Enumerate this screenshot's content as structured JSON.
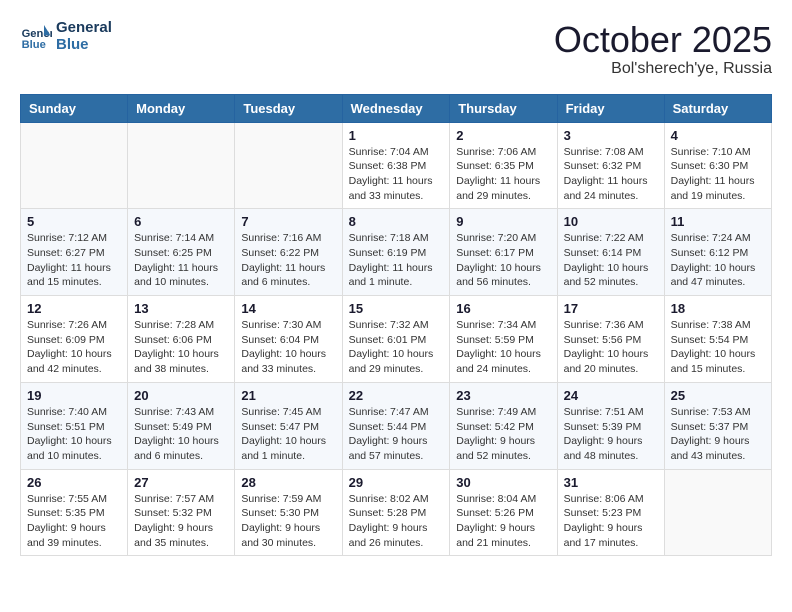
{
  "header": {
    "logo_line1": "General",
    "logo_line2": "Blue",
    "month_title": "October 2025",
    "location": "Bol'sherech'ye, Russia"
  },
  "days_of_week": [
    "Sunday",
    "Monday",
    "Tuesday",
    "Wednesday",
    "Thursday",
    "Friday",
    "Saturday"
  ],
  "weeks": [
    [
      {
        "day": "",
        "info": ""
      },
      {
        "day": "",
        "info": ""
      },
      {
        "day": "",
        "info": ""
      },
      {
        "day": "1",
        "info": "Sunrise: 7:04 AM\nSunset: 6:38 PM\nDaylight: 11 hours and 33 minutes."
      },
      {
        "day": "2",
        "info": "Sunrise: 7:06 AM\nSunset: 6:35 PM\nDaylight: 11 hours and 29 minutes."
      },
      {
        "day": "3",
        "info": "Sunrise: 7:08 AM\nSunset: 6:32 PM\nDaylight: 11 hours and 24 minutes."
      },
      {
        "day": "4",
        "info": "Sunrise: 7:10 AM\nSunset: 6:30 PM\nDaylight: 11 hours and 19 minutes."
      }
    ],
    [
      {
        "day": "5",
        "info": "Sunrise: 7:12 AM\nSunset: 6:27 PM\nDaylight: 11 hours and 15 minutes."
      },
      {
        "day": "6",
        "info": "Sunrise: 7:14 AM\nSunset: 6:25 PM\nDaylight: 11 hours and 10 minutes."
      },
      {
        "day": "7",
        "info": "Sunrise: 7:16 AM\nSunset: 6:22 PM\nDaylight: 11 hours and 6 minutes."
      },
      {
        "day": "8",
        "info": "Sunrise: 7:18 AM\nSunset: 6:19 PM\nDaylight: 11 hours and 1 minute."
      },
      {
        "day": "9",
        "info": "Sunrise: 7:20 AM\nSunset: 6:17 PM\nDaylight: 10 hours and 56 minutes."
      },
      {
        "day": "10",
        "info": "Sunrise: 7:22 AM\nSunset: 6:14 PM\nDaylight: 10 hours and 52 minutes."
      },
      {
        "day": "11",
        "info": "Sunrise: 7:24 AM\nSunset: 6:12 PM\nDaylight: 10 hours and 47 minutes."
      }
    ],
    [
      {
        "day": "12",
        "info": "Sunrise: 7:26 AM\nSunset: 6:09 PM\nDaylight: 10 hours and 42 minutes."
      },
      {
        "day": "13",
        "info": "Sunrise: 7:28 AM\nSunset: 6:06 PM\nDaylight: 10 hours and 38 minutes."
      },
      {
        "day": "14",
        "info": "Sunrise: 7:30 AM\nSunset: 6:04 PM\nDaylight: 10 hours and 33 minutes."
      },
      {
        "day": "15",
        "info": "Sunrise: 7:32 AM\nSunset: 6:01 PM\nDaylight: 10 hours and 29 minutes."
      },
      {
        "day": "16",
        "info": "Sunrise: 7:34 AM\nSunset: 5:59 PM\nDaylight: 10 hours and 24 minutes."
      },
      {
        "day": "17",
        "info": "Sunrise: 7:36 AM\nSunset: 5:56 PM\nDaylight: 10 hours and 20 minutes."
      },
      {
        "day": "18",
        "info": "Sunrise: 7:38 AM\nSunset: 5:54 PM\nDaylight: 10 hours and 15 minutes."
      }
    ],
    [
      {
        "day": "19",
        "info": "Sunrise: 7:40 AM\nSunset: 5:51 PM\nDaylight: 10 hours and 10 minutes."
      },
      {
        "day": "20",
        "info": "Sunrise: 7:43 AM\nSunset: 5:49 PM\nDaylight: 10 hours and 6 minutes."
      },
      {
        "day": "21",
        "info": "Sunrise: 7:45 AM\nSunset: 5:47 PM\nDaylight: 10 hours and 1 minute."
      },
      {
        "day": "22",
        "info": "Sunrise: 7:47 AM\nSunset: 5:44 PM\nDaylight: 9 hours and 57 minutes."
      },
      {
        "day": "23",
        "info": "Sunrise: 7:49 AM\nSunset: 5:42 PM\nDaylight: 9 hours and 52 minutes."
      },
      {
        "day": "24",
        "info": "Sunrise: 7:51 AM\nSunset: 5:39 PM\nDaylight: 9 hours and 48 minutes."
      },
      {
        "day": "25",
        "info": "Sunrise: 7:53 AM\nSunset: 5:37 PM\nDaylight: 9 hours and 43 minutes."
      }
    ],
    [
      {
        "day": "26",
        "info": "Sunrise: 7:55 AM\nSunset: 5:35 PM\nDaylight: 9 hours and 39 minutes."
      },
      {
        "day": "27",
        "info": "Sunrise: 7:57 AM\nSunset: 5:32 PM\nDaylight: 9 hours and 35 minutes."
      },
      {
        "day": "28",
        "info": "Sunrise: 7:59 AM\nSunset: 5:30 PM\nDaylight: 9 hours and 30 minutes."
      },
      {
        "day": "29",
        "info": "Sunrise: 8:02 AM\nSunset: 5:28 PM\nDaylight: 9 hours and 26 minutes."
      },
      {
        "day": "30",
        "info": "Sunrise: 8:04 AM\nSunset: 5:26 PM\nDaylight: 9 hours and 21 minutes."
      },
      {
        "day": "31",
        "info": "Sunrise: 8:06 AM\nSunset: 5:23 PM\nDaylight: 9 hours and 17 minutes."
      },
      {
        "day": "",
        "info": ""
      }
    ]
  ]
}
